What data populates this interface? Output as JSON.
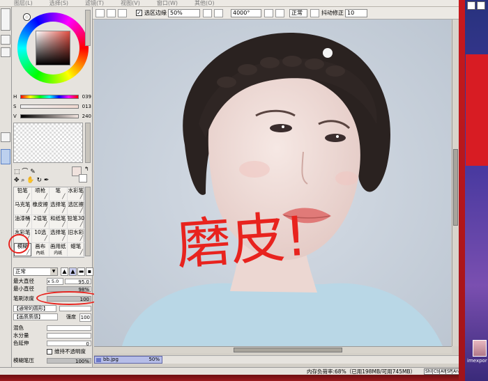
{
  "menu": [
    "图层(L)",
    "选择(S)",
    "滤镜(T)",
    "视图(V)",
    "窗口(W)",
    "其他(O)"
  ],
  "toolbar": {
    "selection_edge_label": "选区边缘",
    "zoom": "50%",
    "rotation": "4000°",
    "mode": "正常",
    "stabilizer_label": "抖动修正",
    "stabilizer_value": "10"
  },
  "color": {
    "h_label": "H",
    "h_value": "039",
    "s_label": "S",
    "s_value": "013",
    "v_label": "V",
    "v_value": "240",
    "current_hex": "#f0e2dd",
    "wheel_selected_hex": "#e04e42"
  },
  "tools": [
    {
      "label": "铅笔",
      "icon": "pencil-icon"
    },
    {
      "label": "喷枪",
      "icon": "airbrush-icon"
    },
    {
      "label": "笔",
      "icon": "brush-icon"
    },
    {
      "label": "水彩笔",
      "icon": "watercolor-icon"
    },
    {
      "label": "马克笔",
      "icon": "marker-icon"
    },
    {
      "label": "橡皮擦",
      "icon": "eraser-icon"
    },
    {
      "label": "选择笔",
      "icon": "select-pen-icon"
    },
    {
      "label": "选区擦",
      "icon": "select-eraser-icon"
    },
    {
      "label": "油漆桶",
      "icon": "bucket-icon"
    },
    {
      "label": "2值笔",
      "icon": "binary-pen-icon"
    },
    {
      "label": "和纸笔",
      "icon": "washi-pen-icon"
    },
    {
      "label": "铅笔30",
      "icon": "pencil30-icon"
    },
    {
      "label": "水彩笔",
      "icon": "watercolor-icon"
    },
    {
      "label": "10选",
      "icon": "select-icon"
    },
    {
      "label": "选择笔",
      "icon": "select-pen-icon"
    },
    {
      "label": "旧水彩",
      "icon": "old-watercolor-icon"
    },
    {
      "label": "模糊",
      "icon": "blur-icon"
    },
    {
      "label": "画布",
      "icon": "canvas-icon"
    },
    {
      "label": "画用纸",
      "icon": "paper-icon"
    },
    {
      "label": "蜡笔",
      "icon": "crayon-icon"
    }
  ],
  "tool_sublabels": [
    "內纸",
    "内纸"
  ],
  "brush": {
    "blend_mode": "正常",
    "size_multiplier": "x 5.0",
    "size_value": "95.0",
    "max_diameter_label": "最大直径",
    "min_diameter_label": "最小直径",
    "min_diameter_value": "98%",
    "density_label": "笔刷浓度",
    "density_value": "100",
    "shape_label": "【通常的圆形】",
    "texture_label": "【画质质感】",
    "strength_label": "强度",
    "strength_value": "100",
    "blend_label": "混色",
    "water_label": "水分量",
    "persistence_label": "色延伸",
    "persistence_value": "0",
    "opacity_check_label": "维持不透明度",
    "blur_pressure_label": "模糊笔压",
    "blur_pressure_value": "100%",
    "density_fill": 1.0,
    "blend_fill": 0.0,
    "water_fill": 0.0,
    "blur_pressure_fill": 1.0
  },
  "canvas": {
    "annotation_text": "磨皮!",
    "annotation_color": "#e8231e"
  },
  "layer": {
    "file_name": "bb.jpg",
    "zoom": "50%"
  },
  "status": {
    "memory_text": "内存负荷率:68%（已用198MB/可用745MB）",
    "indicators": [
      "Shift",
      "Ctrl",
      "Alt",
      "SPC",
      "Any"
    ]
  },
  "desktop": {
    "caption": "imexpor"
  }
}
